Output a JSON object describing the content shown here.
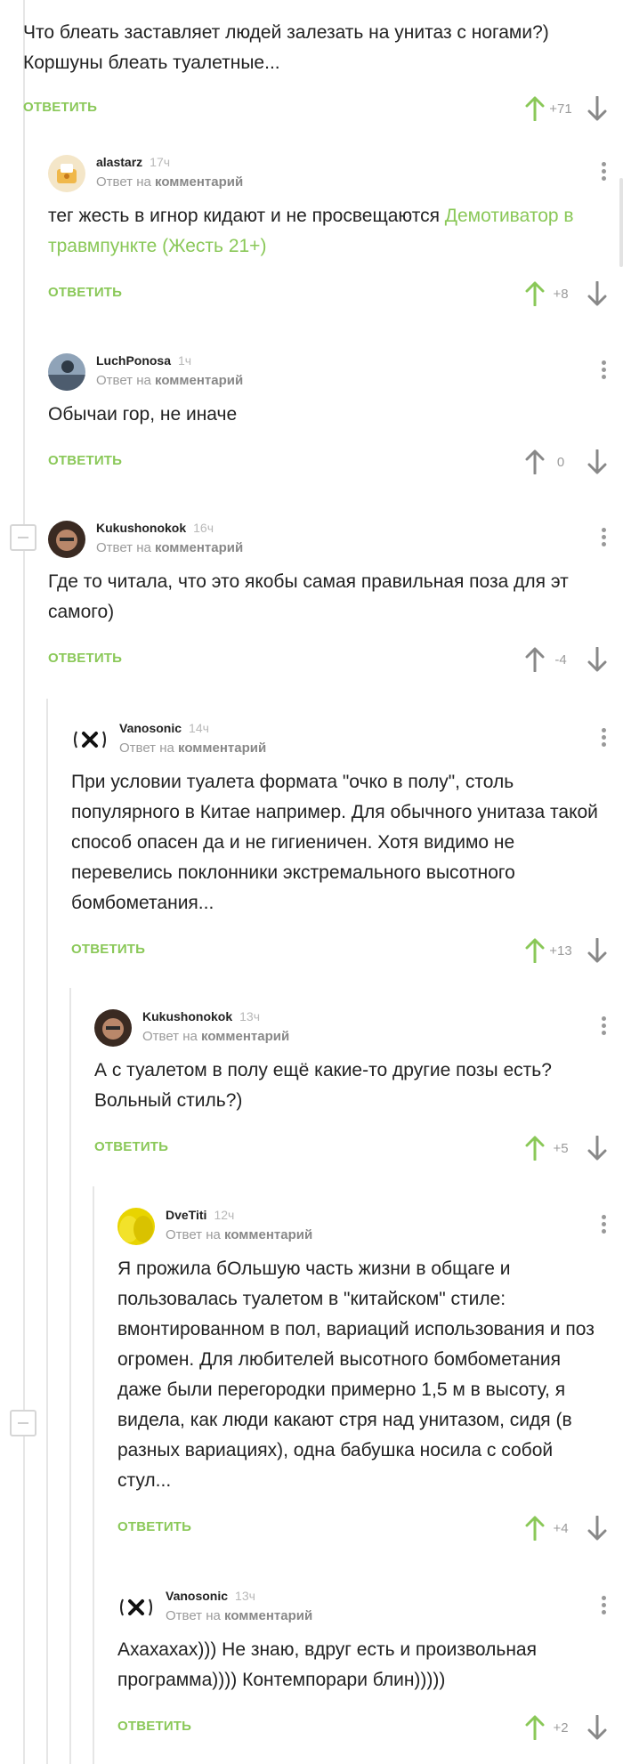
{
  "top": {
    "text": "Что блеать заставляет людей залезать на унитаз с ногами?) Коршуны блеать туалетные...",
    "reply_label": "ОТВЕТИТЬ",
    "rating": "+71"
  },
  "reply_to_label": "Ответ на",
  "reply_to_target": "комментарий",
  "reply_label": "ОТВЕТИТЬ",
  "comments": [
    {
      "username": "alastarz",
      "time": "17ч",
      "text": "тег жесть в игнор кидают и не просвещаются ",
      "link": "Демотиватор в травмпункте (Жесть 21+)",
      "rating": "+8",
      "voted_up": true
    },
    {
      "username": "LuchPonosa",
      "time": "1ч",
      "text": "Обычаи гор, не иначе",
      "rating": "0",
      "voted_up": false
    },
    {
      "username": "Kukushonokok",
      "time": "16ч",
      "text": "Где то читала, что это якобы самая правильная поза для эт самого)",
      "rating": "-4",
      "voted_up": false
    },
    {
      "username": "Vanosonic",
      "time": "14ч",
      "text": "При условии туалета формата \"очко в полу\", столь популярного в Китае например. Для обычного унитаза такой способ опасен да и не гигиеничен. Хотя видимо не перевелись поклонники экстремального высотного бомбометания...",
      "rating": "+13",
      "voted_up": true
    },
    {
      "username": "Kukushonokok",
      "time": "13ч",
      "text": "А с туалетом в полу ещё какие-то другие позы есть? Вольный стиль?)",
      "rating": "+5",
      "voted_up": true
    },
    {
      "username": "DveTiti",
      "time": "12ч",
      "text": "Я прожила бОльшую часть жизни в общаге и пользовалась туалетом в \"китайском\" стиле: вмонтированном в пол, вариаций использования и поз огромен. Для любителей высотного бомбометания даже были перегородки примерно 1,5 м в высоту,  я видела, как люди какают стря над унитазом, сидя (в разных вариациях), одна бабушка носила с собой стул...",
      "rating": "+4",
      "voted_up": true
    },
    {
      "username": "Vanosonic",
      "time": "13ч",
      "text": "Ахахахах))) Не знаю, вдруг есть и произвольная программа)))) Контемпорари блин)))))",
      "rating": "+2",
      "voted_up": true
    }
  ],
  "colors": {
    "accent": "#8ac858",
    "muted": "#9b9b9b",
    "text": "#222222",
    "thread_line": "#e6e6e6"
  }
}
